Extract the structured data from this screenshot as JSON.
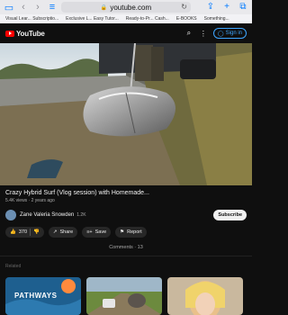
{
  "browser": {
    "url": "youtube.com",
    "bookmarks": [
      "Visual Lear... Subscriptio...",
      "Exclusive L... Easy Tutor...",
      "Ready-to-Pr... Cash...",
      "E-BOOKS",
      "Something..."
    ]
  },
  "header": {
    "logo_text": "YouTube",
    "signin_label": "Sign in"
  },
  "video": {
    "title": "Crazy Hybrid Surf (Vlog session) with Homemade...",
    "views": "5.4K views · 2 years ago",
    "channel_name": "Zane Valeria Snowden",
    "subscribers": "1.2K",
    "subscribe_label": "Subscribe",
    "likes": "370",
    "share_label": "Share",
    "save_label": "Save",
    "report_label": "Report",
    "comments_label": "Comments · 13"
  },
  "related": {
    "label": "Related",
    "thumb1_text": "PATHWAYS"
  }
}
